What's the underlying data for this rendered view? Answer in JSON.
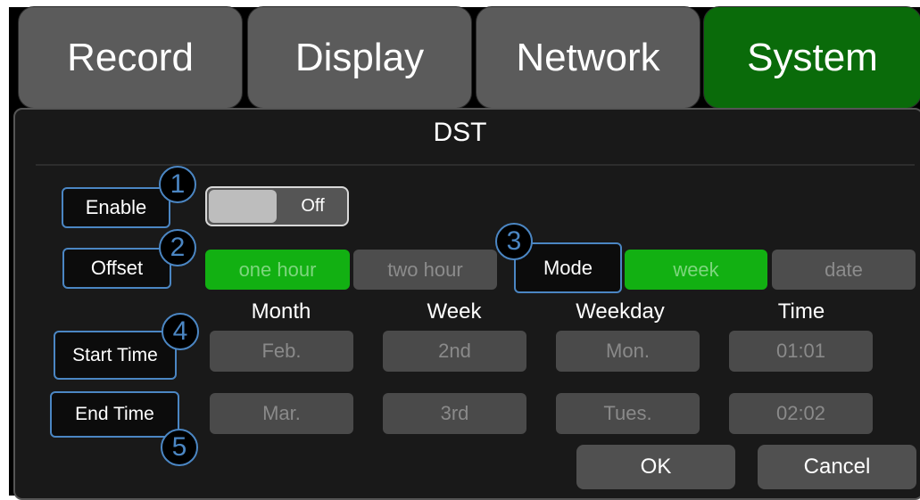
{
  "tabs": [
    {
      "label": "Record",
      "active": false
    },
    {
      "label": "Display",
      "active": false
    },
    {
      "label": "Network",
      "active": false
    },
    {
      "label": "System",
      "active": true
    }
  ],
  "dialog": {
    "title": "DST"
  },
  "annotations": [
    "1",
    "2",
    "3",
    "4",
    "5"
  ],
  "enable": {
    "label": "Enable",
    "toggle_text": "Off",
    "state": "off"
  },
  "offset": {
    "label": "Offset",
    "options": [
      "one hour",
      "two hour"
    ],
    "selected": "one hour"
  },
  "mode": {
    "label": "Mode",
    "options": [
      "week",
      "date"
    ],
    "selected": "week"
  },
  "columns": [
    "Month",
    "Week",
    "Weekday",
    "Time"
  ],
  "start_time": {
    "label": "Start Time",
    "values": [
      "Feb.",
      "2nd",
      "Mon.",
      "01:01"
    ]
  },
  "end_time": {
    "label": "End Time",
    "values": [
      "Mar.",
      "3rd",
      "Tues.",
      "02:02"
    ]
  },
  "actions": {
    "ok": "OK",
    "cancel": "Cancel"
  },
  "colors": {
    "accent_green": "#12b012",
    "active_tab": "#0a6b0a",
    "annotation_blue": "#4b86c3"
  }
}
